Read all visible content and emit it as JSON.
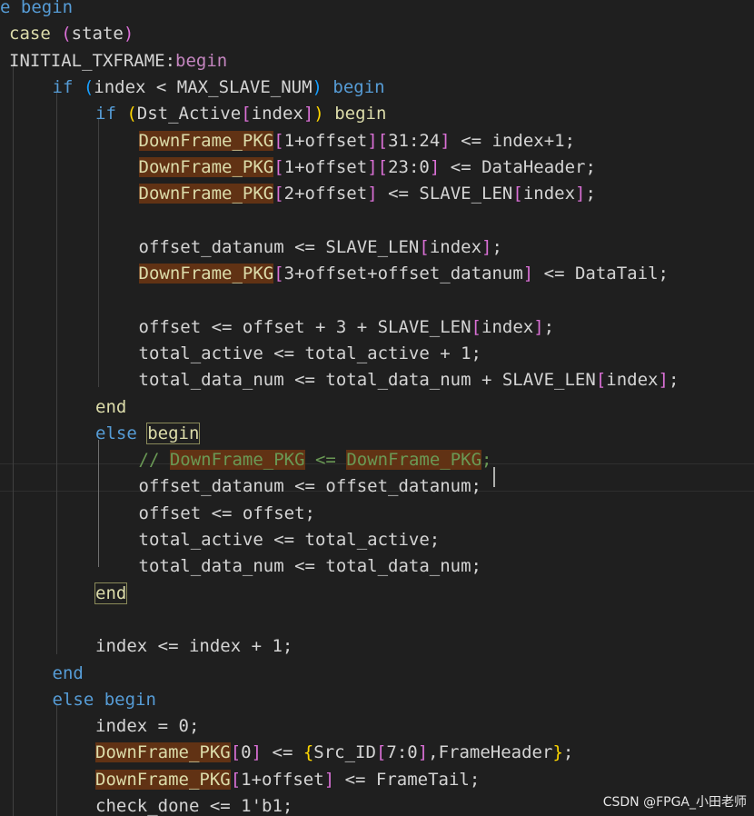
{
  "colors": {
    "background": "#1f1f1f",
    "keyword_blue": "#569cd6",
    "control_purple": "#c586c0",
    "identifier_light": "#9cdcfe",
    "number_green": "#b5cea8",
    "comment_green": "#6a9955",
    "highlight_bg": "#613214"
  },
  "lines": [
    {
      "indent": 0,
      "tokens": [
        {
          "t": "e begin",
          "c": "kw"
        }
      ]
    },
    {
      "indent": 0,
      "tokens": [
        {
          "t": "case",
          "c": "yel"
        },
        {
          "t": " ",
          "c": "txt"
        },
        {
          "t": "(",
          "c": "bracket-p"
        },
        {
          "t": "state",
          "c": "txt"
        },
        {
          "t": ")",
          "c": "bracket-p"
        }
      ]
    },
    {
      "indent": 0,
      "tokens": [
        {
          "t": "INITIAL_TXFRAME",
          "c": "txt"
        },
        {
          "t": ":",
          "c": "txt"
        },
        {
          "t": "begin",
          "c": "ctl"
        }
      ]
    },
    {
      "indent": 1,
      "tokens": [
        {
          "t": "if",
          "c": "kw"
        },
        {
          "t": " ",
          "c": "txt"
        },
        {
          "t": "(",
          "c": "bracket-b"
        },
        {
          "t": "index < MAX_SLAVE_NUM",
          "c": "txt"
        },
        {
          "t": ")",
          "c": "bracket-b"
        },
        {
          "t": " ",
          "c": "txt"
        },
        {
          "t": "begin",
          "c": "kw"
        }
      ]
    },
    {
      "indent": 2,
      "tokens": [
        {
          "t": "if",
          "c": "kw"
        },
        {
          "t": " ",
          "c": "txt"
        },
        {
          "t": "(",
          "c": "bracket-y"
        },
        {
          "t": "Dst_Active",
          "c": "txt"
        },
        {
          "t": "[",
          "c": "bracket-p"
        },
        {
          "t": "index",
          "c": "txt"
        },
        {
          "t": "]",
          "c": "bracket-p"
        },
        {
          "t": ")",
          "c": "bracket-y"
        },
        {
          "t": " ",
          "c": "txt"
        },
        {
          "t": "begin",
          "c": "yel"
        }
      ]
    },
    {
      "indent": 3,
      "tokens": [
        {
          "t": "DownFrame_PKG",
          "c": "yel hl"
        },
        {
          "t": "[",
          "c": "bracket-p"
        },
        {
          "t": "1+offset",
          "c": "txt"
        },
        {
          "t": "]",
          "c": "bracket-p"
        },
        {
          "t": "[",
          "c": "bracket-p"
        },
        {
          "t": "31:24",
          "c": "txt"
        },
        {
          "t": "]",
          "c": "bracket-p"
        },
        {
          "t": " <= index+1;",
          "c": "txt"
        }
      ]
    },
    {
      "indent": 3,
      "tokens": [
        {
          "t": "DownFrame_PKG",
          "c": "yel hl"
        },
        {
          "t": "[",
          "c": "bracket-p"
        },
        {
          "t": "1+offset",
          "c": "txt"
        },
        {
          "t": "]",
          "c": "bracket-p"
        },
        {
          "t": "[",
          "c": "bracket-p"
        },
        {
          "t": "23:0",
          "c": "txt"
        },
        {
          "t": "]",
          "c": "bracket-p"
        },
        {
          "t": " <= DataHeader;",
          "c": "txt"
        }
      ]
    },
    {
      "indent": 3,
      "tokens": [
        {
          "t": "DownFrame_PKG",
          "c": "yel hl"
        },
        {
          "t": "[",
          "c": "bracket-p"
        },
        {
          "t": "2+offset",
          "c": "txt"
        },
        {
          "t": "]",
          "c": "bracket-p"
        },
        {
          "t": " <= SLAVE_LEN",
          "c": "txt"
        },
        {
          "t": "[",
          "c": "bracket-p"
        },
        {
          "t": "index",
          "c": "txt"
        },
        {
          "t": "]",
          "c": "bracket-p"
        },
        {
          "t": ";",
          "c": "txt"
        }
      ]
    },
    {
      "indent": 3,
      "tokens": []
    },
    {
      "indent": 3,
      "tokens": [
        {
          "t": "offset_datanum <= SLAVE_LEN",
          "c": "txt"
        },
        {
          "t": "[",
          "c": "bracket-p"
        },
        {
          "t": "index",
          "c": "txt"
        },
        {
          "t": "]",
          "c": "bracket-p"
        },
        {
          "t": ";",
          "c": "txt"
        }
      ]
    },
    {
      "indent": 3,
      "tokens": [
        {
          "t": "DownFrame_PKG",
          "c": "yel hl"
        },
        {
          "t": "[",
          "c": "bracket-p"
        },
        {
          "t": "3+offset+offset_datanum",
          "c": "txt"
        },
        {
          "t": "]",
          "c": "bracket-p"
        },
        {
          "t": " <= DataTail;",
          "c": "txt"
        }
      ]
    },
    {
      "indent": 3,
      "tokens": []
    },
    {
      "indent": 3,
      "tokens": [
        {
          "t": "offset <= offset + 3 + SLAVE_LEN",
          "c": "txt"
        },
        {
          "t": "[",
          "c": "bracket-p"
        },
        {
          "t": "index",
          "c": "txt"
        },
        {
          "t": "]",
          "c": "bracket-p"
        },
        {
          "t": ";",
          "c": "txt"
        }
      ]
    },
    {
      "indent": 3,
      "tokens": [
        {
          "t": "total_active <= total_active + 1;",
          "c": "txt"
        }
      ]
    },
    {
      "indent": 3,
      "tokens": [
        {
          "t": "total_data_num <= total_data_num + SLAVE_LEN",
          "c": "txt"
        },
        {
          "t": "[",
          "c": "bracket-p"
        },
        {
          "t": "index",
          "c": "txt"
        },
        {
          "t": "]",
          "c": "bracket-p"
        },
        {
          "t": ";",
          "c": "txt"
        }
      ]
    },
    {
      "indent": 2,
      "tokens": [
        {
          "t": "end",
          "c": "yel"
        }
      ]
    },
    {
      "indent": 2,
      "tokens": [
        {
          "t": "else",
          "c": "kw"
        },
        {
          "t": " ",
          "c": "txt"
        },
        {
          "t": "begin",
          "c": "yel box"
        }
      ]
    },
    {
      "indent": 3,
      "tokens": [
        {
          "t": "// ",
          "c": "comment"
        },
        {
          "t": "DownFrame_PKG",
          "c": "comment hl"
        },
        {
          "t": " <= ",
          "c": "comment"
        },
        {
          "t": "DownFrame_PKG",
          "c": "comment hl"
        },
        {
          "t": ";",
          "c": "comment"
        }
      ]
    },
    {
      "indent": 3,
      "tokens": [
        {
          "t": "offset_datanum <= offset_datanum;",
          "c": "txt"
        }
      ]
    },
    {
      "indent": 3,
      "tokens": [
        {
          "t": "offset <= offset;",
          "c": "txt"
        }
      ]
    },
    {
      "indent": 3,
      "tokens": [
        {
          "t": "total_active <= total_active;",
          "c": "txt"
        }
      ]
    },
    {
      "indent": 3,
      "tokens": [
        {
          "t": "total_data_num <= total_data_num;",
          "c": "txt"
        }
      ]
    },
    {
      "indent": 2,
      "tokens": [
        {
          "t": "end",
          "c": "yel box"
        }
      ]
    },
    {
      "indent": 2,
      "tokens": []
    },
    {
      "indent": 2,
      "tokens": [
        {
          "t": "index <= index + 1;",
          "c": "txt"
        }
      ]
    },
    {
      "indent": 1,
      "tokens": [
        {
          "t": "end",
          "c": "kw"
        }
      ]
    },
    {
      "indent": 1,
      "tokens": [
        {
          "t": "else",
          "c": "kw"
        },
        {
          "t": " ",
          "c": "txt"
        },
        {
          "t": "begin",
          "c": "kw"
        }
      ]
    },
    {
      "indent": 2,
      "tokens": [
        {
          "t": "index = 0;",
          "c": "txt"
        }
      ]
    },
    {
      "indent": 2,
      "tokens": [
        {
          "t": "DownFrame_PKG",
          "c": "yel hl"
        },
        {
          "t": "[",
          "c": "bracket-p"
        },
        {
          "t": "0",
          "c": "txt"
        },
        {
          "t": "]",
          "c": "bracket-p"
        },
        {
          "t": " <= ",
          "c": "txt"
        },
        {
          "t": "{",
          "c": "bracket-y"
        },
        {
          "t": "Src_ID",
          "c": "txt"
        },
        {
          "t": "[",
          "c": "bracket-p"
        },
        {
          "t": "7:0",
          "c": "txt"
        },
        {
          "t": "]",
          "c": "bracket-p"
        },
        {
          "t": ",FrameHeader",
          "c": "txt"
        },
        {
          "t": "}",
          "c": "bracket-y"
        },
        {
          "t": ";",
          "c": "txt"
        }
      ]
    },
    {
      "indent": 2,
      "tokens": [
        {
          "t": "DownFrame_PKG",
          "c": "yel hl"
        },
        {
          "t": "[",
          "c": "bracket-p"
        },
        {
          "t": "1+offset",
          "c": "txt"
        },
        {
          "t": "]",
          "c": "bracket-p"
        },
        {
          "t": " <= FrameTail;",
          "c": "txt"
        }
      ]
    },
    {
      "indent": 2,
      "tokens": [
        {
          "t": "check_done <= 1'b1;",
          "c": "txt"
        }
      ]
    }
  ],
  "watermark": "CSDN @FPGA_小田老师"
}
